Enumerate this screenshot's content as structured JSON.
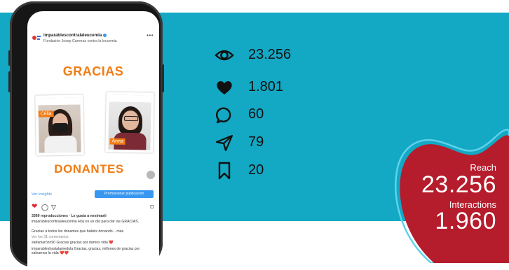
{
  "post": {
    "account": "imparablescontralaleucemia",
    "account_sub": "Fundación Josep Carreras contra la leucemia",
    "more_icon": "more-dots-icon",
    "title_top": "GRACIAS",
    "title_bottom": "DONANTES",
    "photo_left_tag": "Célia",
    "photo_right_tag": "Anna",
    "insights_link": "Ver insights",
    "promote_button": "Promocionar publicación",
    "reproductions": "3369 reproducciones · Le gusta a nesimarti",
    "caption": "imparablescontralaleucemia Hoy es un día para dar las GRACIAS.",
    "caption_more": "Gracias a todos los donantes que habéis donando... más",
    "comments_link": "Ver los 31 comentarios",
    "comment1": "stefaniarozo90 Gracias gracias por darnos vida ❤️",
    "comment2": "imparableshastalamedula Gracias, gracias, millones de gracias por salvarnos la vida ❤️❤️"
  },
  "stats": [
    {
      "icon": "eye-icon",
      "value": "23.256"
    },
    {
      "icon": "heart-icon",
      "value": "1.801"
    },
    {
      "icon": "comment-icon",
      "value": "60"
    },
    {
      "icon": "send-icon",
      "value": "79"
    },
    {
      "icon": "bookmark-icon",
      "value": "20"
    }
  ],
  "summary": {
    "reach_label": "Reach",
    "reach_value": "23.256",
    "interactions_label": "Interactions",
    "interactions_value": "1.960"
  },
  "colors": {
    "band": "#13a8c4",
    "heart": "#b51c2c",
    "heart_outline": "#5fd1ea",
    "accent_orange": "#f07c14",
    "link_blue": "#3897f0"
  }
}
